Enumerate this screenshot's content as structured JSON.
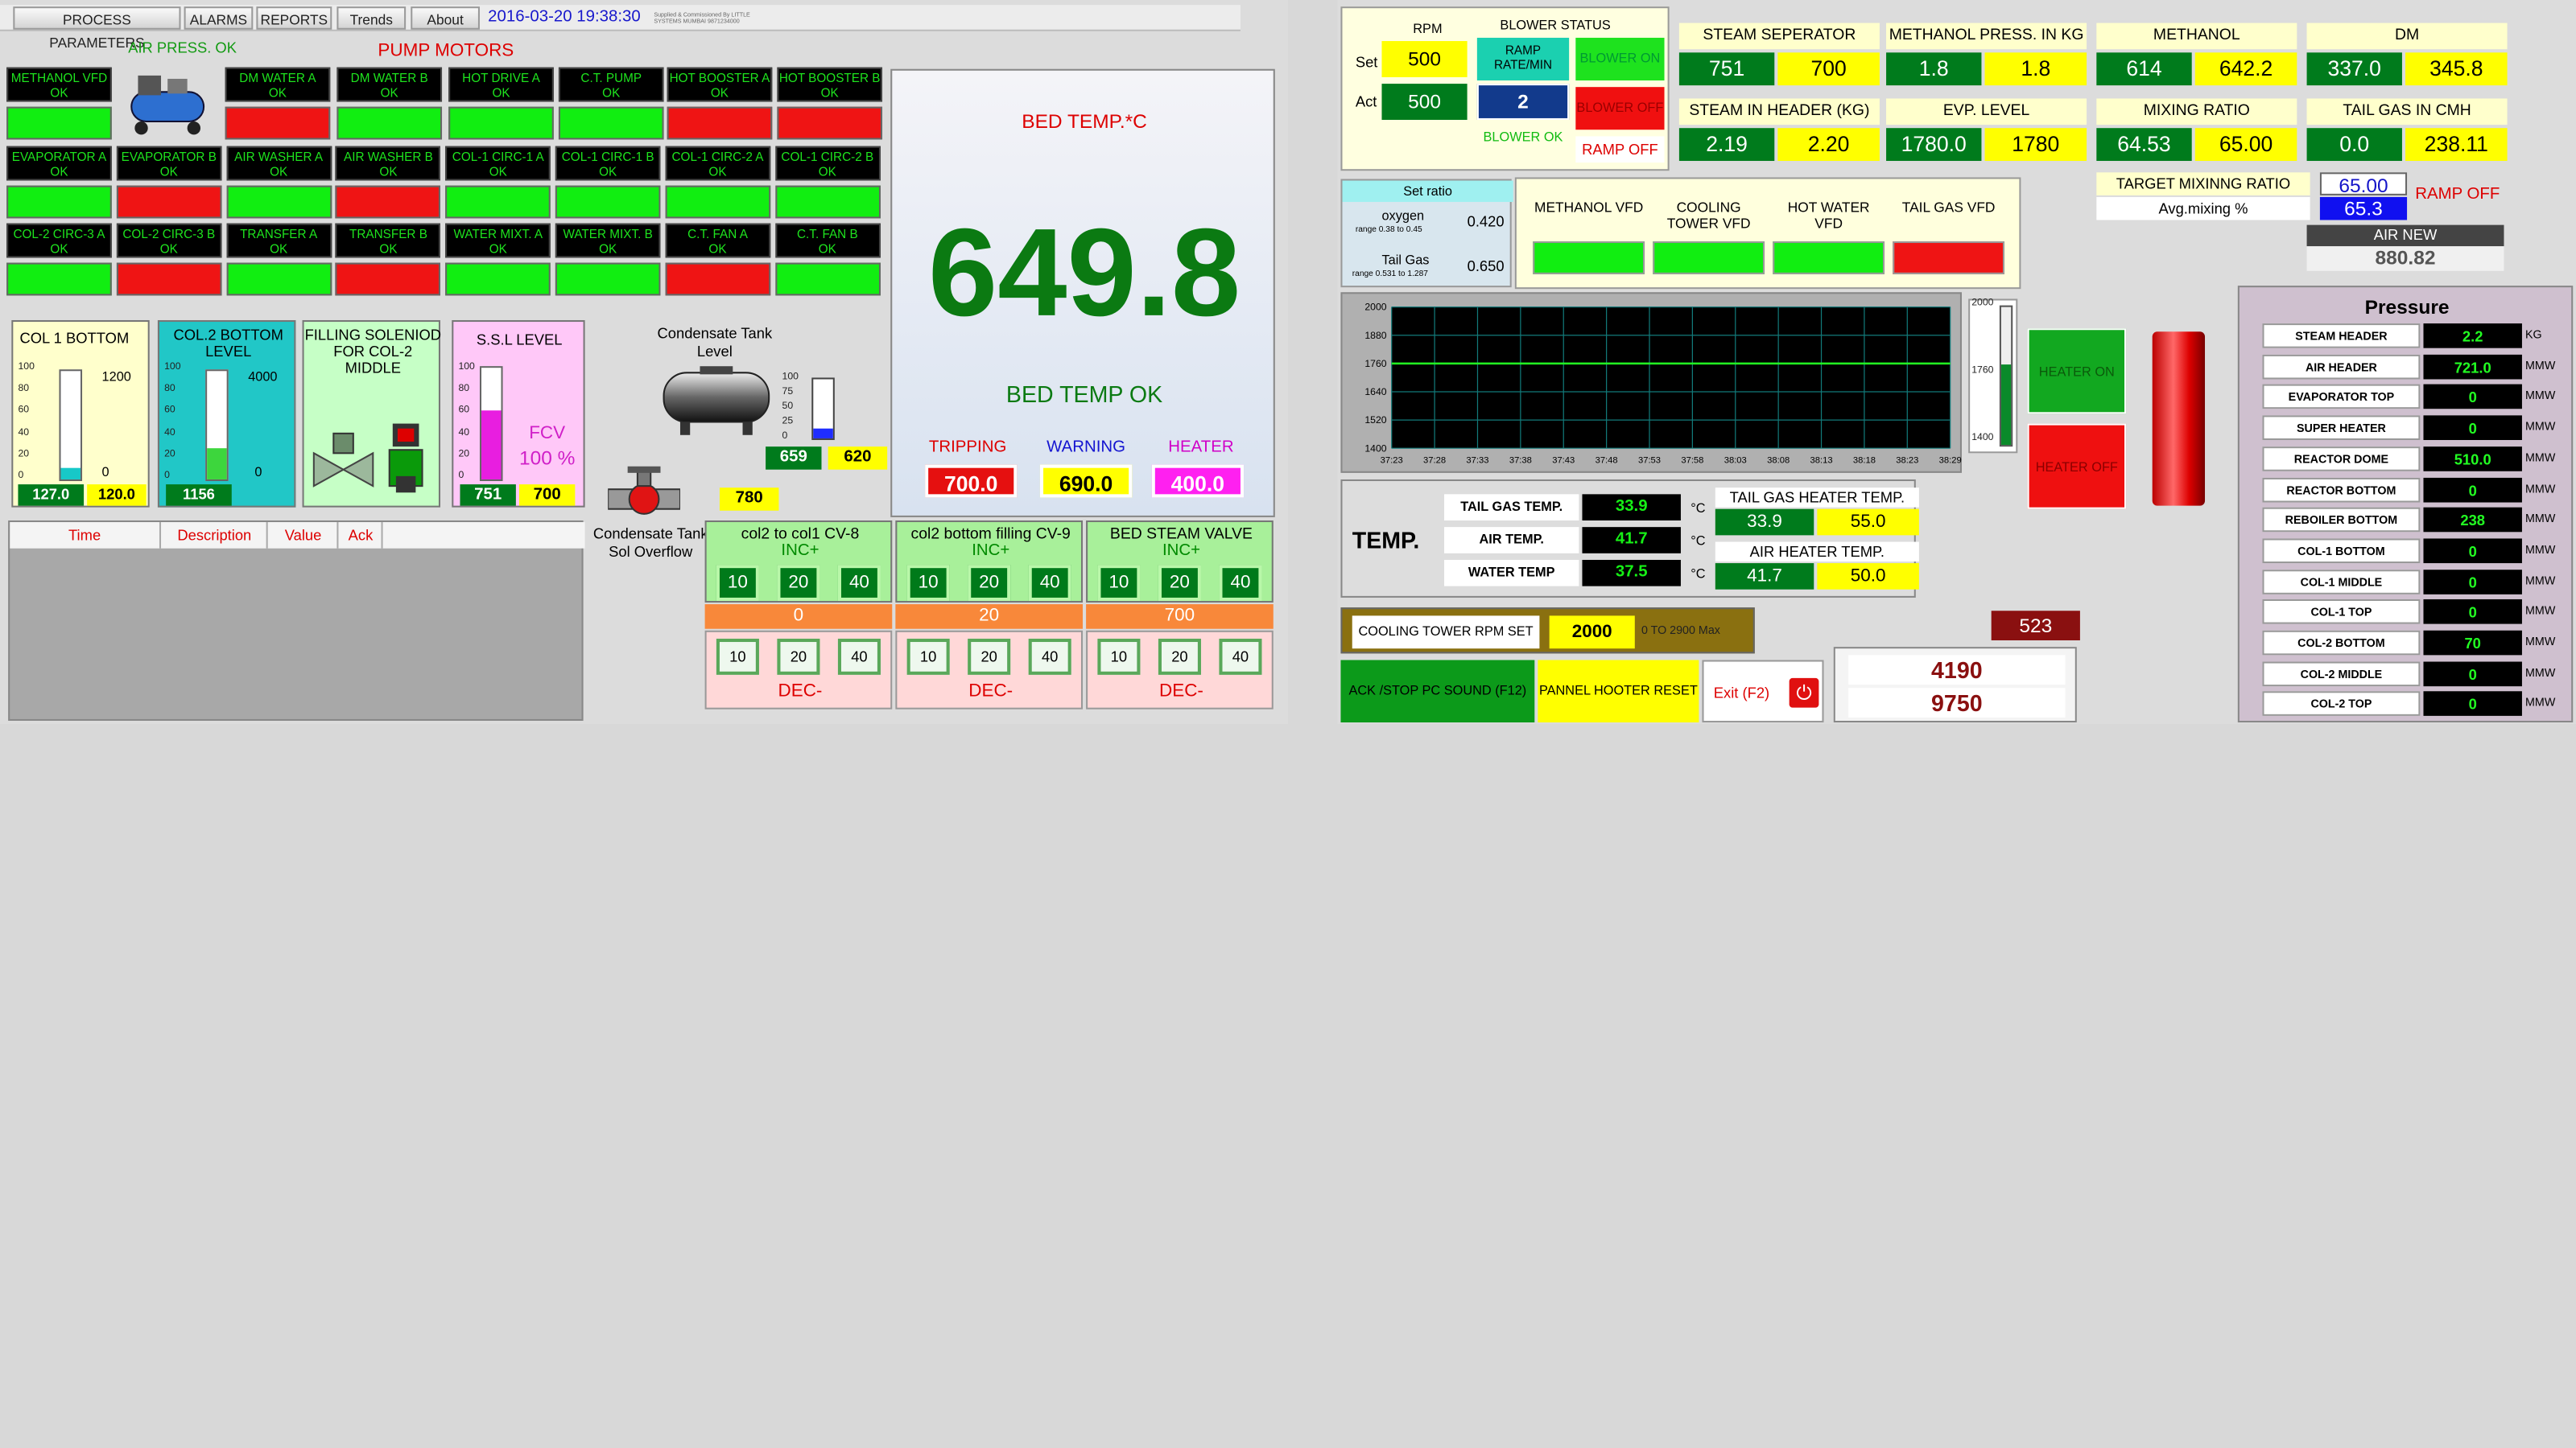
{
  "menu": {
    "items": [
      "PROCESS PARAMETERS",
      "ALARMS",
      "REPORTS",
      "Trends",
      "About"
    ],
    "datetime": "2016-03-20 19:38:30",
    "credit": "Supplied & Commissioned By LITTLE SYSTEMS MUMBAI 9871234000"
  },
  "air_press": "AIR PRESS. OK",
  "pump_title": "PUMP MOTORS",
  "motors": [
    {
      "n": "METHANOL VFD",
      "s": "OK",
      "c": "g"
    },
    {
      "n": "DM WATER A",
      "s": "OK",
      "c": "r"
    },
    {
      "n": "DM WATER B",
      "s": "OK",
      "c": "g"
    },
    {
      "n": "HOT DRIVE A",
      "s": "OK",
      "c": "g"
    },
    {
      "n": "C.T. PUMP",
      "s": "OK",
      "c": "g"
    },
    {
      "n": "HOT BOOSTER A",
      "s": "OK",
      "c": "r"
    },
    {
      "n": "HOT BOOSTER B",
      "s": "OK",
      "c": "r"
    },
    {
      "n": "EVAPORATOR A",
      "s": "OK",
      "c": "g"
    },
    {
      "n": "EVAPORATOR B",
      "s": "OK",
      "c": "r"
    },
    {
      "n": "AIR WASHER A",
      "s": "OK",
      "c": "g"
    },
    {
      "n": "AIR WASHER B",
      "s": "OK",
      "c": "r"
    },
    {
      "n": "COL-1 CIRC-1 A",
      "s": "OK",
      "c": "g"
    },
    {
      "n": "COL-1 CIRC-1 B",
      "s": "OK",
      "c": "g"
    },
    {
      "n": "COL-1 CIRC-2 A",
      "s": "OK",
      "c": "g"
    },
    {
      "n": "COL-1 CIRC-2 B",
      "s": "OK",
      "c": "g"
    },
    {
      "n": "COL-2 CIRC-3 A",
      "s": "OK",
      "c": "g"
    },
    {
      "n": "COL-2 CIRC-3 B",
      "s": "OK",
      "c": "r"
    },
    {
      "n": "TRANSFER A",
      "s": "OK",
      "c": "g"
    },
    {
      "n": "TRANSFER B",
      "s": "OK",
      "c": "r"
    },
    {
      "n": "WATER MIXT. A",
      "s": "OK",
      "c": "g"
    },
    {
      "n": "WATER MIXT. B",
      "s": "OK",
      "c": "g"
    },
    {
      "n": "C.T. FAN A",
      "s": "OK",
      "c": "r"
    },
    {
      "n": "C.T. FAN B",
      "s": "OK",
      "c": "g"
    }
  ],
  "col1": {
    "title": "COL 1 BOTTOM",
    "max": "1200",
    "min": "0",
    "v1": "127.0",
    "v2": "120.0",
    "ticks": [
      "100",
      "80",
      "60",
      "40",
      "20",
      "0"
    ],
    "level": 0.11
  },
  "col2": {
    "title": "COL.2 BOTTOM LEVEL",
    "max": "4000",
    "min": "0",
    "v1": "1156",
    "ticks": [
      "100",
      "80",
      "60",
      "40",
      "20",
      "0"
    ],
    "level": 0.29
  },
  "filling": {
    "title": "FILLING SOLENIOD FOR COL-2 MIDDLE"
  },
  "ssl": {
    "title": "S.S.L LEVEL",
    "fcv": "FCV",
    "pct": "100 %",
    "v1": "751",
    "v2": "700",
    "ticks": [
      "100",
      "80",
      "60",
      "40",
      "20",
      "0"
    ],
    "level": 0.62
  },
  "condensate": {
    "title": "Condensate Tank Level",
    "v1": "659",
    "v2": "620",
    "v3": "780",
    "sol": "Condensate Tank Sol Overflow",
    "ticks": [
      "100",
      "75",
      "50",
      "25",
      "0"
    ],
    "level": 0.16
  },
  "alarm_table": {
    "headers": [
      "Time",
      "Description",
      "Value",
      "Ack"
    ]
  },
  "bed": {
    "title": "BED TEMP.*C",
    "value": "649.8",
    "status": "BED TEMP OK",
    "labels": [
      "TRIPPING",
      "WARNING",
      "HEATER"
    ],
    "values": [
      "700.0",
      "690.0",
      "400.0"
    ]
  },
  "valves": [
    {
      "title": "col2 to col1 CV-8",
      "inc": "INC+",
      "b": [
        "10",
        "20",
        "40"
      ],
      "v": "0",
      "dec": "DEC-"
    },
    {
      "title": "col2 bottom filling CV-9",
      "inc": "INC+",
      "b": [
        "10",
        "20",
        "40"
      ],
      "v": "20",
      "dec": "DEC-"
    },
    {
      "title": "BED STEAM VALVE",
      "inc": "INC+",
      "b": [
        "10",
        "20",
        "40"
      ],
      "v": "700",
      "dec": "DEC-"
    }
  ],
  "blower": {
    "rpm": "RPM",
    "status": "BLOWER STATUS",
    "set": "Set",
    "act": "Act",
    "set_v": "500",
    "act_v": "500",
    "ramp": "RAMP RATE/MIN",
    "ramp_v": "2",
    "on": "BLOWER ON",
    "off": "BLOWER OFF",
    "ok": "BLOWER OK",
    "rampoff": "RAMP OFF"
  },
  "params": [
    {
      "n": "STEAM SEPERATOR",
      "a": "751",
      "b": "700"
    },
    {
      "n": "METHANOL PRESS. IN KG",
      "a": "1.8",
      "b": "1.8"
    },
    {
      "n": "METHANOL",
      "a": "614",
      "b": "642.2"
    },
    {
      "n": "DM",
      "a": "337.0",
      "b": "345.8"
    },
    {
      "n": "STEAM  IN HEADER (KG)",
      "a": "2.19",
      "b": "2.20"
    },
    {
      "n": "EVP. LEVEL",
      "a": "1780.0",
      "b": "1780"
    },
    {
      "n": "MIXING RATIO",
      "a": "64.53",
      "b": "65.00"
    },
    {
      "n": "TAIL GAS IN CMH",
      "a": "0.0",
      "b": "238.11"
    }
  ],
  "target": {
    "title": "TARGET MIXINNG RATIO",
    "avg": "Avg.mixing %",
    "v1": "65.00",
    "v2": "65.3",
    "rampoff": "RAMP OFF",
    "airnew": "AIR NEW",
    "airval": "880.82"
  },
  "setratio": {
    "title": "Set ratio",
    "oxy": "oxygen",
    "oxyr": "range 0.38 to 0.45",
    "oxyv": "0.420",
    "tg": "Tail Gas",
    "tgr": "range 0.531 to 1.287",
    "tgv": "0.650"
  },
  "vfd": [
    {
      "n": "METHANOL VFD"
    },
    {
      "n": "COOLING TOWER VFD"
    },
    {
      "n": "HOT WATER VFD"
    },
    {
      "n": "TAIL GAS VFD"
    }
  ],
  "trend": {
    "yticks": [
      "2000",
      "1880",
      "1760",
      "1640",
      "1520",
      "1400"
    ],
    "xticks": [
      "37:23",
      "37:28",
      "37:33",
      "37:38",
      "37:43",
      "37:48",
      "37:53",
      "37:58",
      "38:03",
      "38:08",
      "38:13",
      "38:18",
      "38:23",
      "38:29"
    ],
    "ymin": 1400,
    "ymax": 2000,
    "line": 1760
  },
  "minibar": {
    "ticks": [
      "2000",
      "1760",
      "1400"
    ],
    "level": 0.58
  },
  "heater": {
    "on": "HEATER ON",
    "off": "HEATER OFF"
  },
  "temp": {
    "title": "TEMP.",
    "rows": [
      {
        "n": "TAIL GAS TEMP.",
        "v": "33.9",
        "u": "°C"
      },
      {
        "n": "AIR TEMP.",
        "v": "41.7",
        "u": "°C"
      },
      {
        "n": "WATER TEMP",
        "v": "37.5",
        "u": "°C"
      }
    ],
    "tgh": "TAIL GAS HEATER TEMP.",
    "tgh_a": "33.9",
    "tgh_b": "55.0",
    "ah": "AIR HEATER TEMP.",
    "ah_a": "41.7",
    "ah_b": "50.0"
  },
  "ct": {
    "label": "COOLING TOWER RPM SET",
    "v": "2000",
    "range": "0 TO 2900 Max"
  },
  "bottom": {
    "ack": "ACK /STOP PC SOUND (F12)",
    "reset": "PANNEL HOOTER RESET",
    "exit": "Exit (F2)",
    "n523": "523",
    "n4190": "4190",
    "n9750": "9750"
  },
  "pressure": {
    "title": "Pressure",
    "rows": [
      {
        "n": "STEAM HEADER",
        "v": "2.2",
        "u": "KG"
      },
      {
        "n": "AIR  HEADER",
        "v": "721.0",
        "u": "MMW"
      },
      {
        "n": "EVAPORATOR TOP",
        "v": "0",
        "u": "MMW"
      },
      {
        "n": "SUPER HEATER",
        "v": "0",
        "u": "MMW"
      },
      {
        "n": "REACTOR DOME",
        "v": "510.0",
        "u": "MMW"
      },
      {
        "n": "REACTOR BOTTOM",
        "v": "0",
        "u": "MMW"
      },
      {
        "n": "REBOILER BOTTOM",
        "v": "238",
        "u": "MMW"
      },
      {
        "n": "COL-1 BOTTOM",
        "v": "0",
        "u": "MMW"
      },
      {
        "n": "COL-1 MIDDLE",
        "v": "0",
        "u": "MMW"
      },
      {
        "n": "COL-1 TOP",
        "v": "0",
        "u": "MMW"
      },
      {
        "n": "COL-2 BOTTOM",
        "v": "70",
        "u": "MMW"
      },
      {
        "n": "COL-2 MIDDLE",
        "v": "0",
        "u": "MMW"
      },
      {
        "n": "COL-2 TOP",
        "v": "0",
        "u": "MMW"
      }
    ]
  }
}
